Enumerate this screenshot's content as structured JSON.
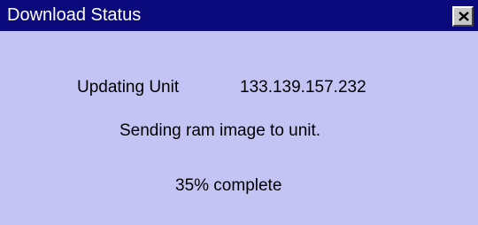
{
  "window": {
    "title": "Download Status",
    "colors": {
      "titlebar": "#0a0a7d",
      "title_text": "#ffffff",
      "body": "#c4c4f4",
      "close_button_face": "#c6c6c6"
    }
  },
  "title_bar": {
    "close_icon": "close-icon"
  },
  "status": {
    "unit_label": "Updating Unit",
    "unit_address": "133.139.157.232",
    "message": "Sending ram image to unit.",
    "progress_text": "35% complete",
    "progress_percent": 35
  }
}
